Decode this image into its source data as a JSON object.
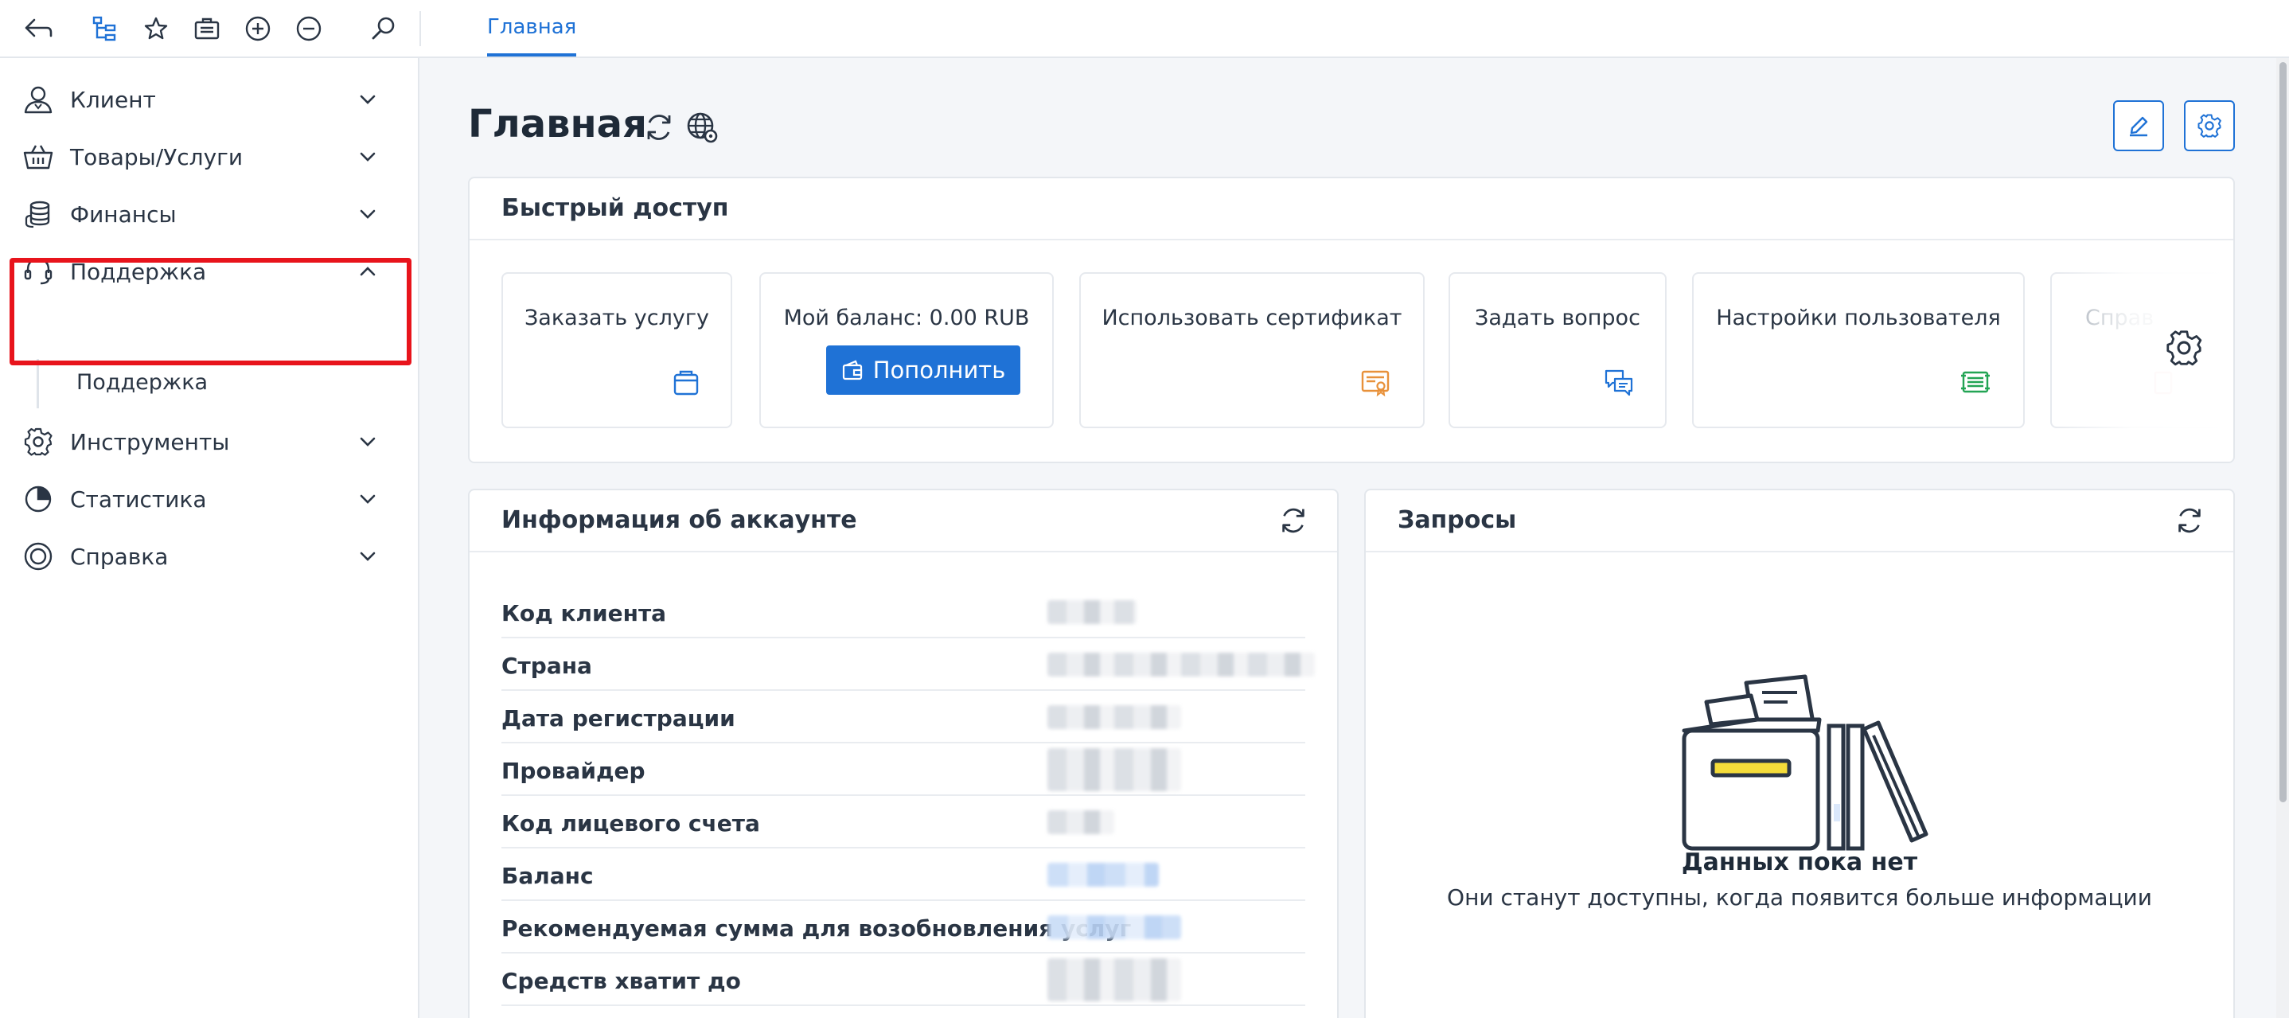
{
  "colors": {
    "accent": "#1f72d6",
    "highlight_border": "#e8141c",
    "text": "#2a3544",
    "certificate_icon": "#e8913a",
    "settings_icon": "#23a454"
  },
  "toolbar": {
    "icons": [
      "back-arrow-icon",
      "tree-structure-icon",
      "star-icon",
      "briefcase-icon",
      "zoom-in-icon",
      "zoom-out-icon",
      "search-icon"
    ]
  },
  "tabs": [
    {
      "label": "Главная",
      "active": true
    }
  ],
  "sidebar": {
    "items": [
      {
        "label": "Клиент",
        "icon": "user-icon",
        "expanded": false
      },
      {
        "label": "Товары/Услуги",
        "icon": "basket-icon",
        "expanded": false
      },
      {
        "label": "Финансы",
        "icon": "coins-icon",
        "expanded": false
      },
      {
        "label": "Поддержка",
        "icon": "headset-icon",
        "expanded": true,
        "children": [
          {
            "label": "Поддержка"
          }
        ]
      },
      {
        "label": "Инструменты",
        "icon": "gear-icon",
        "expanded": false
      },
      {
        "label": "Статистика",
        "icon": "pie-chart-icon",
        "expanded": false
      },
      {
        "label": "Справка",
        "icon": "lifebuoy-icon",
        "expanded": false
      }
    ]
  },
  "page": {
    "title": "Главная"
  },
  "quick_access": {
    "title": "Быстрый доступ",
    "tiles": [
      {
        "label": "Заказать услугу",
        "icon": "order-bag-icon"
      },
      {
        "label": "Мой баланс: 0.00 RUB",
        "button_label": "Пополнить",
        "icon": "wallet-icon"
      },
      {
        "label": "Использовать сертификат",
        "icon": "certificate-icon"
      },
      {
        "label": "Задать вопрос",
        "icon": "chat-bubbles-icon"
      },
      {
        "label": "Настройки пользователя",
        "icon": "user-settings-icon"
      },
      {
        "label": "Справ",
        "icon": "help-icon"
      }
    ]
  },
  "account_info": {
    "title": "Информация об аккаунте",
    "rows": [
      {
        "label": "Код клиента"
      },
      {
        "label": "Страна"
      },
      {
        "label": "Дата регистрации"
      },
      {
        "label": "Провайдер"
      },
      {
        "label": "Код лицевого счета"
      },
      {
        "label": "Баланс"
      },
      {
        "label": "Рекомендуемая сумма для возобновления услуг"
      },
      {
        "label": "Средств хватит до"
      }
    ]
  },
  "requests": {
    "title": "Запросы",
    "empty_title": "Данных пока нет",
    "empty_subtitle": "Они станут доступны, когда появится больше информации"
  }
}
